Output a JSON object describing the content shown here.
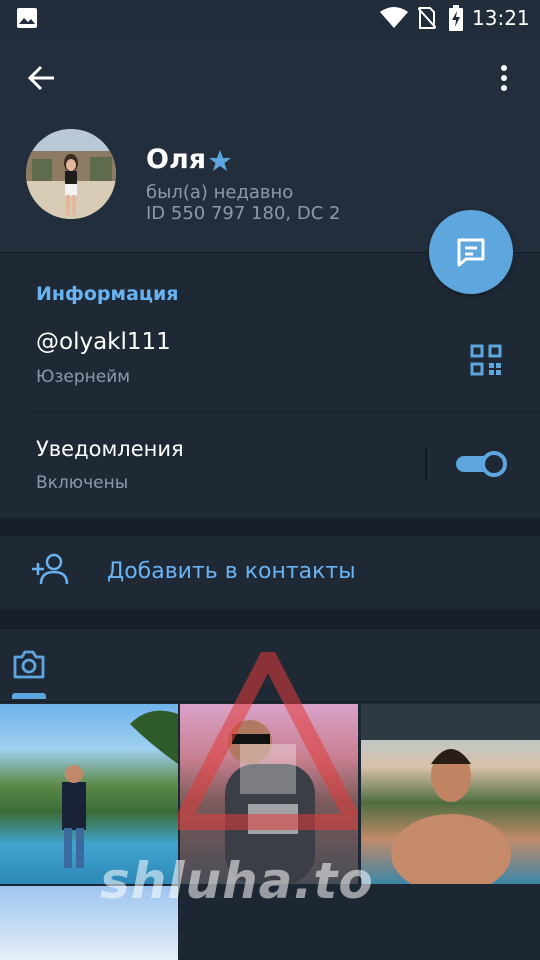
{
  "status_bar": {
    "time": "13:21",
    "icons": [
      "image-icon",
      "wifi-icon",
      "no-sim-icon",
      "battery-charging-icon"
    ]
  },
  "toolbar": {
    "back_icon": "arrow-left-icon",
    "menu_icon": "more-vertical-icon"
  },
  "profile": {
    "name": "Оля",
    "status": "был(а) недавно",
    "id_line": "ID 550 797 180, DC 2",
    "badge_icon": "star-icon",
    "star_color": "#5ea6de"
  },
  "fab": {
    "icon": "message-icon",
    "color": "#5ea6de"
  },
  "info": {
    "section_title": "Информация",
    "username": "@olyakl111",
    "username_label": "Юзернейм",
    "qr_icon": "qr-code-icon",
    "notifications_label": "Уведомления",
    "notifications_status": "Включены",
    "notifications_enabled": true
  },
  "actions": {
    "add_contact_label": "Добавить в контакты",
    "add_contact_icon": "add-user-icon"
  },
  "media_tabs": {
    "active_tab_icon": "camera-icon"
  },
  "watermark": {
    "text": "shluha.to"
  },
  "colors": {
    "accent": "#6ab3f3",
    "header_bg": "#232e3c",
    "card_bg": "#1f2936",
    "secondary_text": "#8b9aab"
  }
}
